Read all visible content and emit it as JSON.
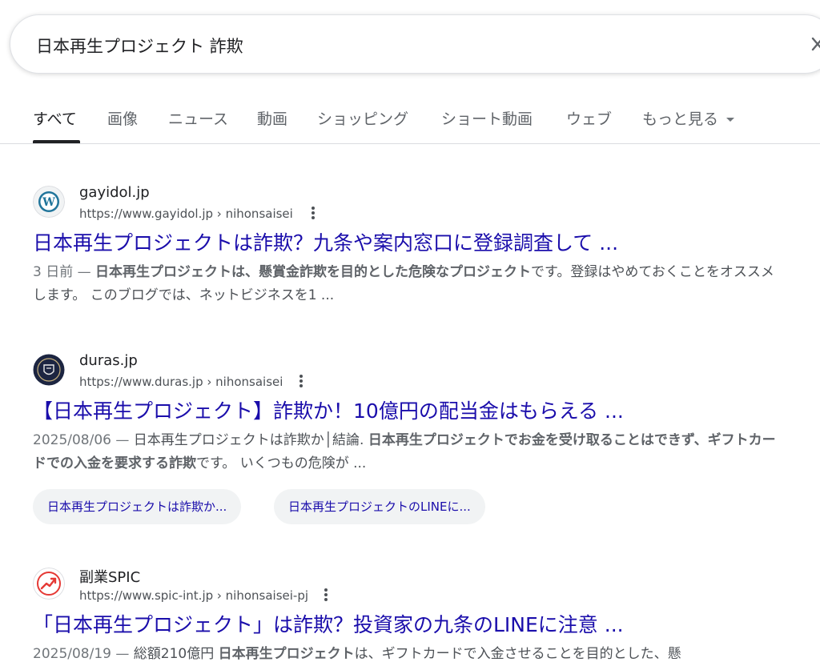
{
  "search": {
    "query": "日本再生プロジェクト 詐欺"
  },
  "tabs": [
    {
      "label": "すべて"
    },
    {
      "label": "画像"
    },
    {
      "label": "ニュース"
    },
    {
      "label": "動画"
    },
    {
      "label": "ショッピング"
    },
    {
      "label": "ショート動画"
    },
    {
      "label": "ウェブ"
    },
    {
      "label": "もっと見る"
    }
  ],
  "results": [
    {
      "site": "gayidol.jp",
      "url": "https://www.gayidol.jp › nihonsaisei",
      "title": "日本再生プロジェクトは詐欺？九条や案内窓口に登録調査して ...",
      "date": "3 日前 — ",
      "snippet": [
        {
          "t": "日本再生プロジェクトは、懸賞金詐欺を目的とした危険なプロジェクト",
          "b": true
        },
        {
          "t": "です。登録はやめておくことをオススメします。 このブログでは、ネットビジネスを1 ...",
          "b": false
        }
      ]
    },
    {
      "site": "duras.jp",
      "url": "https://www.duras.jp › nihonsaisei",
      "title": "【日本再生プロジェクト】詐欺か！10億円の配当金はもらえる ...",
      "date": "2025/08/06 — ",
      "snippet": [
        {
          "t": "日本再生プロジェクトは詐欺か│結論. ",
          "b": false
        },
        {
          "t": "日本再生プロジェクトでお金を受け取ることはできず、ギフトカードでの入金を要求する詐欺",
          "b": true
        },
        {
          "t": "です。 いくつもの危険が ...",
          "b": false
        }
      ],
      "chips": [
        "日本再生プロジェクトは詐欺か...",
        "日本再生プロジェクトのLINEに..."
      ]
    },
    {
      "site": "副業SPIC",
      "url": "https://www.spic-int.jp › nihonsaisei-pj",
      "title": "「日本再生プロジェクト」は詐欺？投資家の九条のLINEに注意 ...",
      "date": "2025/08/19 — ",
      "snippet": [
        {
          "t": "総額210億円 ",
          "b": false
        },
        {
          "t": "日本再生プロジェクト",
          "b": true
        },
        {
          "t": "は、ギフトカードで入金させることを目的とした、懸",
          "b": false
        }
      ]
    }
  ]
}
